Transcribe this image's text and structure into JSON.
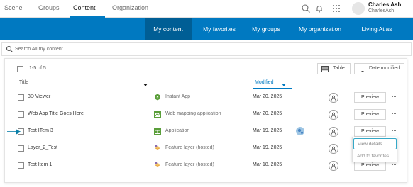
{
  "topnav": {
    "tabs": [
      {
        "label": "Scene"
      },
      {
        "label": "Groups"
      },
      {
        "label": "Content"
      },
      {
        "label": "Organization"
      }
    ],
    "active_tab": "Content",
    "user": {
      "name": "Charles Ash",
      "username": "CharlesAsh"
    },
    "icons": [
      "search-icon",
      "bell-icon",
      "app-launcher-icon"
    ]
  },
  "subnav": {
    "items": [
      {
        "label": "My content"
      },
      {
        "label": "My favorites"
      },
      {
        "label": "My groups"
      },
      {
        "label": "My organization"
      },
      {
        "label": "Living Atlas"
      }
    ],
    "active": "My content"
  },
  "search": {
    "placeholder": "Search All my content"
  },
  "toolbar": {
    "count_label": "1-5 of 5",
    "table_label": "Table",
    "sort_label": "Date modified"
  },
  "columns": {
    "title": "Title",
    "modified": "Modified"
  },
  "rows": [
    {
      "title": "3D Viewer",
      "type": "Instant App",
      "type_icon": "instant-app-icon",
      "modified": "Mar 20, 2025",
      "preview": "Preview"
    },
    {
      "title": "Web App Title Goes Here",
      "type": "Web mapping application",
      "type_icon": "web-mapping-app-icon",
      "modified": "Mar 20, 2025",
      "preview": "Preview"
    },
    {
      "title": "Test ITem 3",
      "type": "Application",
      "type_icon": "application-icon",
      "modified": "Mar 19, 2025",
      "preview": "Preview"
    },
    {
      "title": "Layer_2_Test",
      "type": "Feature layer (hosted)",
      "type_icon": "feature-layer-icon",
      "modified": "Mar 19, 2025",
      "preview": "Preview"
    },
    {
      "title": "Test Item 1",
      "type": "Feature layer (hosted)",
      "type_icon": "feature-layer-icon",
      "modified": "Mar 18, 2025",
      "preview": "Preview"
    }
  ],
  "context_menu": {
    "items": [
      {
        "label": "View details"
      },
      {
        "label": "Add to favorites"
      }
    ]
  },
  "colors": {
    "brand_blue": "#0079c1",
    "active_subnav": "#005e95",
    "link_blue": "#007ac2",
    "focus_ring": "#35a9c8",
    "instant_app_green": "#5a9e3a",
    "feature_layer_orange": "#e8a33b"
  }
}
